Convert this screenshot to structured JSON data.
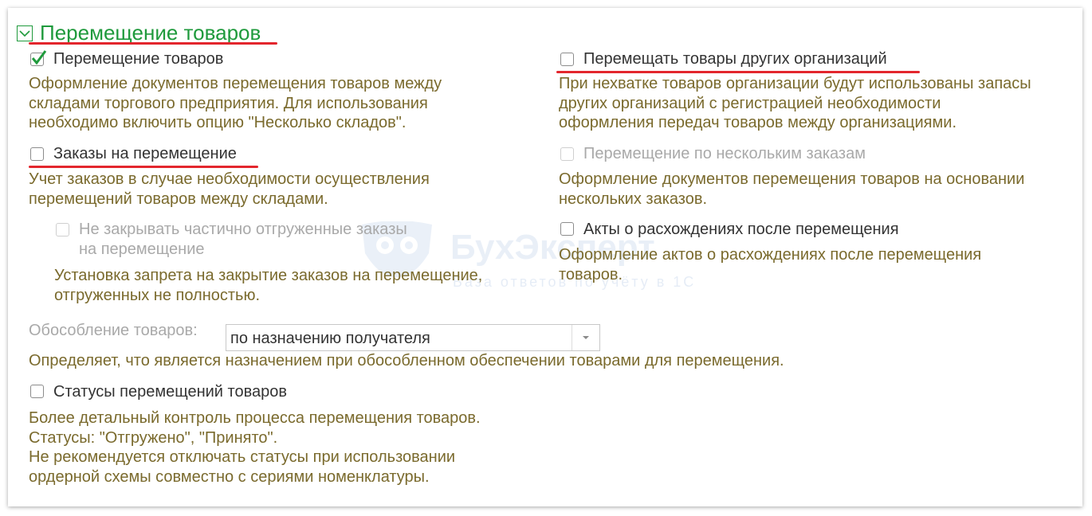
{
  "section": {
    "title": "Перемещение товаров",
    "expanded": true,
    "colors": {
      "title": "#1f9a3c",
      "description": "#7a6a2d",
      "highlight_underline": "#e3262d"
    }
  },
  "watermark": {
    "title": "БухЭксперт",
    "subtitle": "База ответов по учёту в 1С"
  },
  "left": {
    "move_goods": {
      "label": "Перемещение товаров",
      "checked": true,
      "description": "Оформление документов перемещения товаров между\nскладами торгового предприятия. Для использования\nнеобходимо включить опцию \"Несколько складов\"."
    },
    "transfer_orders": {
      "label": "Заказы на перемещение",
      "checked": false,
      "description": "Учет заказов в случае необходимости осуществления\nперемещений товаров между складами."
    },
    "not_close_partial": {
      "label": "Не закрывать частично отгруженные заказы\nна перемещение",
      "checked": false,
      "disabled": true,
      "description": "Установка запрета на закрытие заказов на перемещение,\nотгруженных не полностью."
    },
    "isolation": {
      "label": "Обособление товаров:",
      "value": "по назначению получателя",
      "description": "Определяет, что является назначением при обособленном обеспечении товарами для перемещения."
    },
    "statuses": {
      "label": "Статусы перемещений товаров",
      "checked": false,
      "description": "Более детальный контроль процесса перемещения товаров.\nСтатусы: \"Отгружено\", \"Принято\".\nНе рекомендуется отключать статусы при использовании\nордерной схемы совместно с сериями номенклатуры."
    }
  },
  "right": {
    "other_orgs": {
      "label": "Перемещать товары других организаций",
      "checked": false,
      "description": "При нехватке товаров организации будут использованы запасы\nдругих организаций с регистрацией необходимости\nоформления передач товаров между организациями."
    },
    "multiple_orders": {
      "label": "Перемещение по нескольким заказам",
      "checked": false,
      "disabled": true,
      "description": "Оформление документов перемещения товаров на основании\nнескольких заказов."
    },
    "discrepancy_acts": {
      "label": "Акты о расхождениях после перемещения",
      "checked": false,
      "description": "Оформление актов о расхождениях после перемещения\nтоваров."
    }
  }
}
